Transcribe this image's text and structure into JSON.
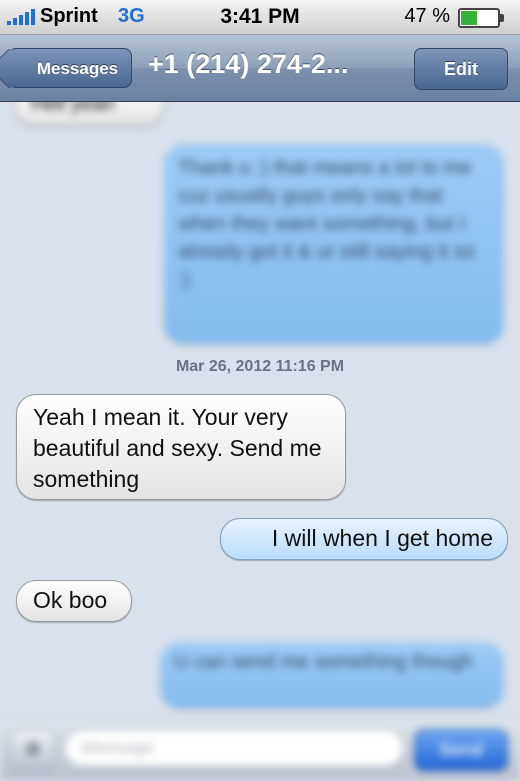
{
  "status_bar": {
    "carrier": "Sprint",
    "network": "3G",
    "time": "3:41 PM",
    "battery_percent": "47 %",
    "battery_level": 0.47
  },
  "nav": {
    "back_label": "Messages",
    "title": "+1 (214) 274-2...",
    "edit_label": "Edit"
  },
  "conversation": {
    "partial_top_text": "Hell yeah",
    "blurred_outgoing_1": "Thank u :) that means a lot to me cuz usually guys only say that when they want something, but I already got it & ur still saying it so :)",
    "timestamp": "Mar 26, 2012 11:16 PM",
    "incoming_1": "Yeah I mean it. Your very beautiful and sexy. Send me something",
    "outgoing_1": "I will when I get home",
    "incoming_2": "Ok boo",
    "blurred_outgoing_2": "U can send me something though"
  },
  "input_bar": {
    "placeholder": "iMessage",
    "send_label": "Send"
  },
  "colors": {
    "incoming_bubble": "#f0f0f0",
    "outgoing_bubble": "#b9dcfa",
    "nav_bar": "#8d9fb9",
    "background": "#d9e1ec"
  }
}
